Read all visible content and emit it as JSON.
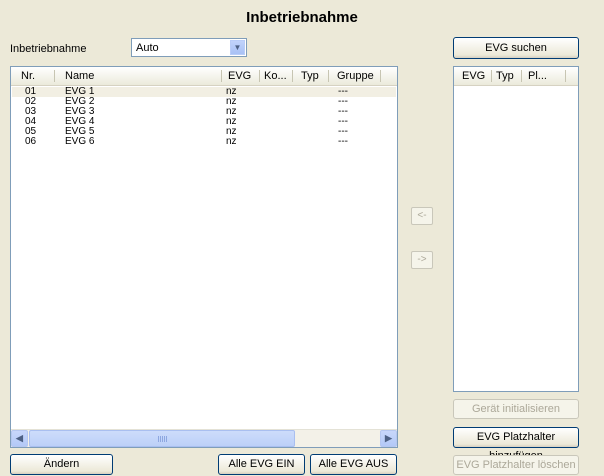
{
  "title": "Inbetriebnahme",
  "mode": {
    "label": "Inbetriebnahme",
    "value": "Auto"
  },
  "left_table": {
    "columns": [
      "Nr.",
      "Name",
      "EVG",
      "Ko...",
      "Typ",
      "Gruppe"
    ],
    "rows": [
      {
        "nr": "01",
        "name": "EVG 1",
        "evg": "nz",
        "ko": "",
        "typ": "",
        "gruppe": "---"
      },
      {
        "nr": "02",
        "name": "EVG 2",
        "evg": "nz",
        "ko": "",
        "typ": "",
        "gruppe": "---"
      },
      {
        "nr": "03",
        "name": "EVG 3",
        "evg": "nz",
        "ko": "",
        "typ": "",
        "gruppe": "---"
      },
      {
        "nr": "04",
        "name": "EVG 4",
        "evg": "nz",
        "ko": "",
        "typ": "",
        "gruppe": "---"
      },
      {
        "nr": "05",
        "name": "EVG 5",
        "evg": "nz",
        "ko": "",
        "typ": "",
        "gruppe": "---"
      },
      {
        "nr": "06",
        "name": "EVG 6",
        "evg": "nz",
        "ko": "",
        "typ": "",
        "gruppe": "---"
      }
    ]
  },
  "right_table": {
    "columns": [
      "EVG",
      "Typ",
      "Pl..."
    ]
  },
  "transfer": {
    "left": "<-",
    "right": "->"
  },
  "buttons": {
    "evg_suchen": "EVG suchen",
    "geraet_init": "Gerät initialisieren",
    "platzhalter_add": "EVG Platzhalter hinzufügen",
    "platzhalter_del": "EVG Platzhalter löschen",
    "aendern": "Ändern",
    "alle_ein": "Alle EVG EIN",
    "alle_aus": "Alle EVG AUS"
  },
  "icons": {
    "dropdown": "chevron-down-icon",
    "scroll_left": "arrow-left-icon",
    "scroll_right": "arrow-right-icon"
  }
}
